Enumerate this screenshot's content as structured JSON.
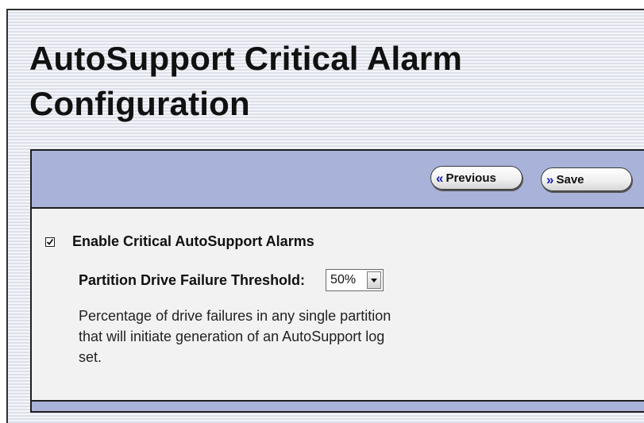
{
  "page": {
    "title": "AutoSupport Critical Alarm Configuration"
  },
  "toolbar": {
    "previous_icon": "«",
    "previous_label": "Previous",
    "save_icon": "»",
    "save_label": "Save"
  },
  "alarms": {
    "enable_label": "Enable Critical AutoSupport Alarms",
    "enable_checked": true,
    "threshold_label": "Partition Drive Failure Threshold:",
    "threshold_value": "50%",
    "description": "Percentage of drive failures in any single partition that will initiate generation of an AutoSupport log set."
  },
  "icons": {
    "previous": "double-chevron-left-icon",
    "save": "double-chevron-right-icon",
    "checkbox": "checkmark-icon",
    "dropdown": "dropdown-arrow-icon"
  },
  "colors": {
    "toolbar_bg": "#a9b3d9",
    "chevron_accent": "#1a1ab5",
    "panel_bg": "#f2f2f2"
  }
}
